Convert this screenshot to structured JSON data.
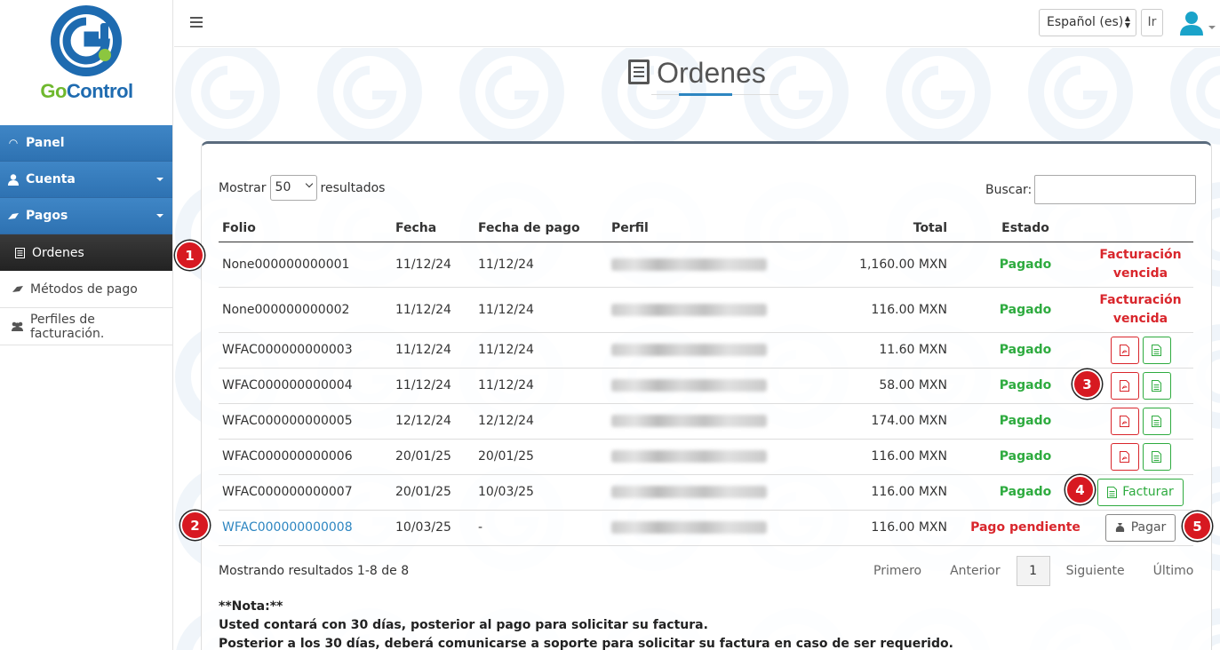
{
  "app": {
    "logo_text_go": "Go",
    "logo_text_control": "Control"
  },
  "sidebar": {
    "items": [
      {
        "label": "Panel",
        "icon": "dashboard-icon"
      },
      {
        "label": "Cuenta",
        "icon": "user-icon"
      },
      {
        "label": "Pagos",
        "icon": "money-icon"
      },
      {
        "label": "Ordenes",
        "icon": "list-icon"
      },
      {
        "label": "Métodos de pago",
        "icon": "money-icon"
      },
      {
        "label": "Perfiles de facturación.",
        "icon": "users-icon"
      }
    ]
  },
  "topbar": {
    "language": "Español (es)",
    "go_label": "Ir"
  },
  "page": {
    "title": "Ordenes"
  },
  "table_controls": {
    "show_prefix": "Mostrar",
    "page_size": "50",
    "show_suffix": "resultados",
    "search_label": "Buscar:"
  },
  "table": {
    "headers": [
      "Folio",
      "Fecha",
      "Fecha de pago",
      "Perfil",
      "Total",
      "Estado"
    ],
    "rows": [
      {
        "folio": "None000000000001",
        "fecha": "11/12/24",
        "fecha_pago": "11/12/24",
        "total": "1,160.00 MXN",
        "estado": "Pagado",
        "action_text": "Facturación vencida"
      },
      {
        "folio": "None000000000002",
        "fecha": "11/12/24",
        "fecha_pago": "11/12/24",
        "total": "116.00 MXN",
        "estado": "Pagado",
        "action_text": "Facturación vencida"
      },
      {
        "folio": "WFAC000000000003",
        "fecha": "11/12/24",
        "fecha_pago": "11/12/24",
        "total": "11.60 MXN",
        "estado": "Pagado"
      },
      {
        "folio": "WFAC000000000004",
        "fecha": "11/12/24",
        "fecha_pago": "11/12/24",
        "total": "58.00 MXN",
        "estado": "Pagado"
      },
      {
        "folio": "WFAC000000000005",
        "fecha": "12/12/24",
        "fecha_pago": "12/12/24",
        "total": "174.00 MXN",
        "estado": "Pagado"
      },
      {
        "folio": "WFAC000000000006",
        "fecha": "20/01/25",
        "fecha_pago": "20/01/25",
        "total": "116.00 MXN",
        "estado": "Pagado"
      },
      {
        "folio": "WFAC000000000007",
        "fecha": "20/01/25",
        "fecha_pago": "10/03/25",
        "total": "116.00 MXN",
        "estado": "Pagado",
        "action_text": "Facturar"
      },
      {
        "folio": "WFAC000000000008",
        "fecha": "10/03/25",
        "fecha_pago": "-",
        "total": "116.00 MXN",
        "estado": "Pago pendiente",
        "action_text": "Pagar"
      }
    ]
  },
  "footer": {
    "showing": "Mostrando resultados 1-8 de 8",
    "pager": {
      "first": "Primero",
      "prev": "Anterior",
      "current": "1",
      "next": "Siguiente",
      "last": "Último"
    },
    "note_title": "**Nota:**",
    "note_line1": "Usted contará con 30 días, posterior al pago para solicitar su factura.",
    "note_line2": "Posterior a los 30 días, deberá comunicarse a soporte para solicitar su factura en caso de ser requerido."
  },
  "markers": [
    "1",
    "2",
    "3",
    "4",
    "5"
  ],
  "colors": {
    "primary": "#2e86c1",
    "paid": "#2eab3f",
    "pending": "#d9262c",
    "sidebar_active": "#2e72b2"
  }
}
